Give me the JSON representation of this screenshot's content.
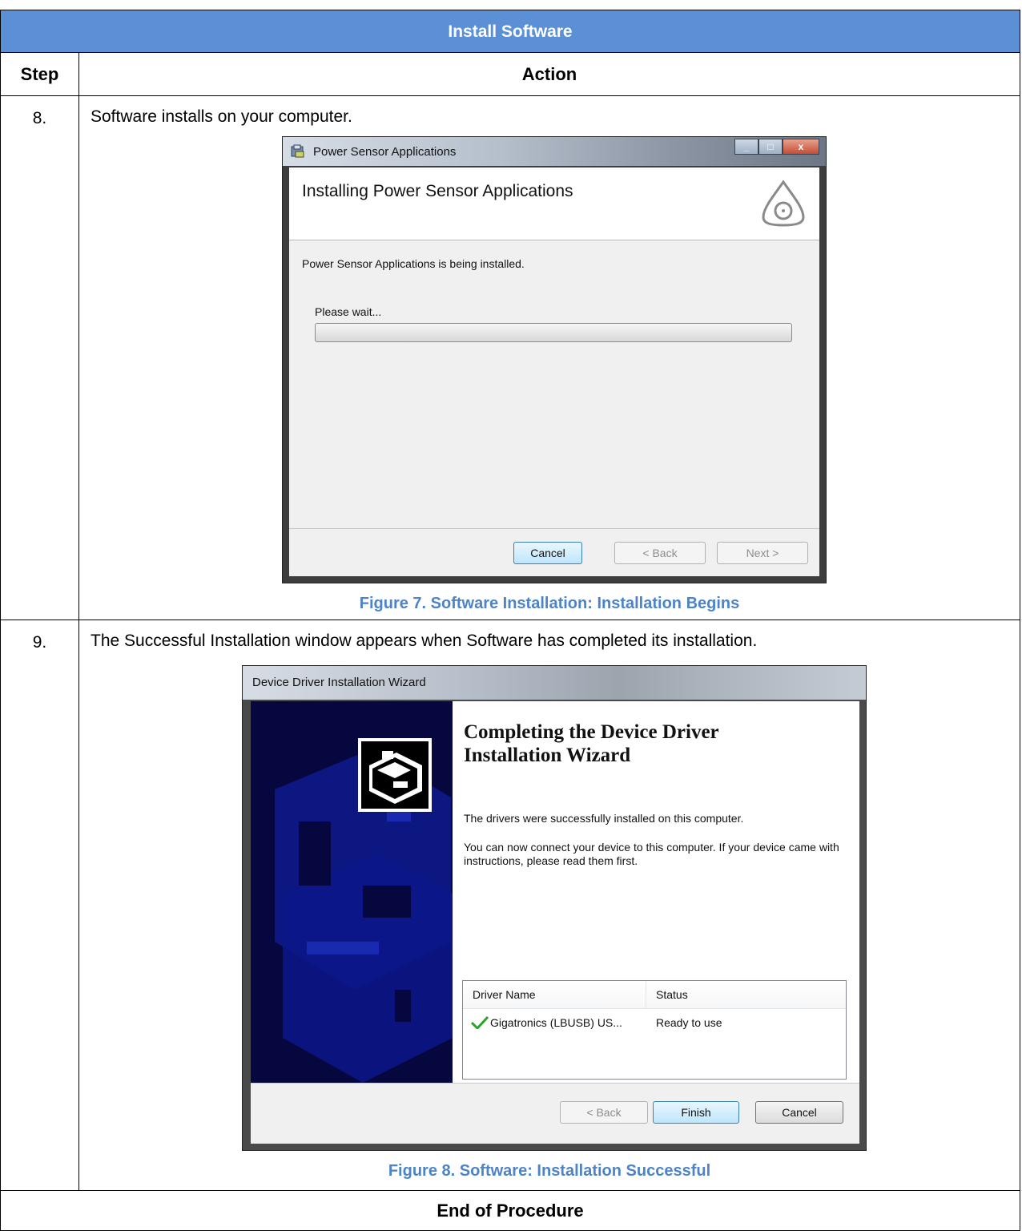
{
  "table": {
    "title": "Install Software",
    "col_step": "Step",
    "col_action": "Action",
    "end": "End of Procedure"
  },
  "steps": [
    {
      "number": "8.",
      "text": "Software installs on your computer.",
      "caption": "Figure 7. Software Installation: Installation Begins"
    },
    {
      "number": "9.",
      "text": "The Successful Installation window appears when Software has completed its installation.",
      "caption": "Figure 8. Software: Installation Successful"
    }
  ],
  "installer": {
    "window_title": "Power Sensor Applications",
    "heading": "Installing Power Sensor Applications",
    "status": "Power Sensor Applications is being installed.",
    "wait": "Please wait...",
    "progress": 0.0,
    "buttons": {
      "cancel": "Cancel",
      "back": "< Back",
      "next": "Next >"
    },
    "controls": {
      "minimize": "_",
      "maximize": "□",
      "close": "x"
    }
  },
  "wizard": {
    "window_title": "Device Driver Installation Wizard",
    "heading_line1": "Completing the Device Driver",
    "heading_line2": "Installation Wizard",
    "text1": "The drivers were successfully installed on this computer.",
    "text2": "You can now connect your device to this computer. If your device came with instructions, please read them first.",
    "list_columns": [
      "Driver Name",
      "Status"
    ],
    "list_rows": [
      {
        "name": "Gigatronics (LBUSB) US...",
        "status": "Ready to use",
        "icon": "check-icon"
      }
    ],
    "buttons": {
      "back": "< Back",
      "finish": "Finish",
      "cancel": "Cancel"
    }
  },
  "colors": {
    "header_blue": "#5b8fd6",
    "caption_blue": "#4d83c9",
    "wizard_sidebar": "#0a0a4a",
    "check_green": "#2aa32a"
  }
}
